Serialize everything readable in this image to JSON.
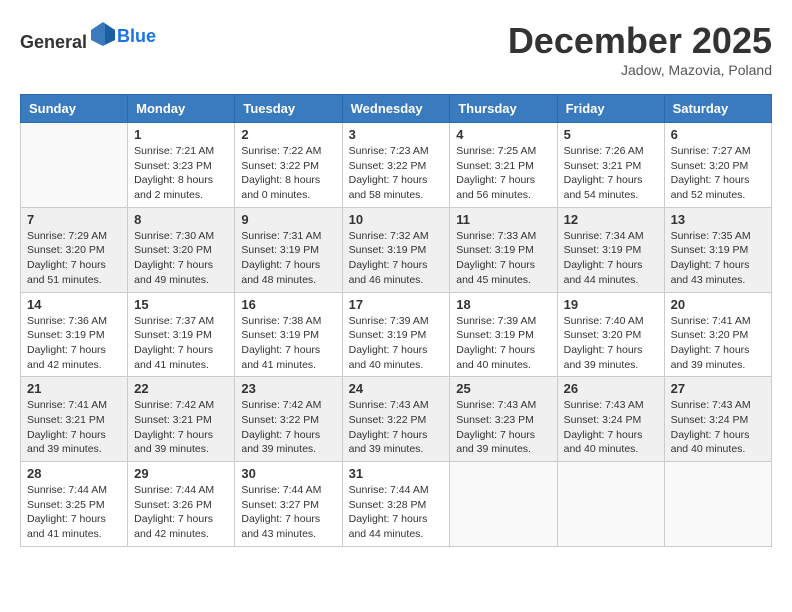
{
  "header": {
    "logo_general": "General",
    "logo_blue": "Blue",
    "month": "December 2025",
    "location": "Jadow, Mazovia, Poland"
  },
  "days_of_week": [
    "Sunday",
    "Monday",
    "Tuesday",
    "Wednesday",
    "Thursday",
    "Friday",
    "Saturday"
  ],
  "weeks": [
    [
      {
        "day": "",
        "info": ""
      },
      {
        "day": "1",
        "info": "Sunrise: 7:21 AM\nSunset: 3:23 PM\nDaylight: 8 hours\nand 2 minutes."
      },
      {
        "day": "2",
        "info": "Sunrise: 7:22 AM\nSunset: 3:22 PM\nDaylight: 8 hours\nand 0 minutes."
      },
      {
        "day": "3",
        "info": "Sunrise: 7:23 AM\nSunset: 3:22 PM\nDaylight: 7 hours\nand 58 minutes."
      },
      {
        "day": "4",
        "info": "Sunrise: 7:25 AM\nSunset: 3:21 PM\nDaylight: 7 hours\nand 56 minutes."
      },
      {
        "day": "5",
        "info": "Sunrise: 7:26 AM\nSunset: 3:21 PM\nDaylight: 7 hours\nand 54 minutes."
      },
      {
        "day": "6",
        "info": "Sunrise: 7:27 AM\nSunset: 3:20 PM\nDaylight: 7 hours\nand 52 minutes."
      }
    ],
    [
      {
        "day": "7",
        "info": "Sunrise: 7:29 AM\nSunset: 3:20 PM\nDaylight: 7 hours\nand 51 minutes."
      },
      {
        "day": "8",
        "info": "Sunrise: 7:30 AM\nSunset: 3:20 PM\nDaylight: 7 hours\nand 49 minutes."
      },
      {
        "day": "9",
        "info": "Sunrise: 7:31 AM\nSunset: 3:19 PM\nDaylight: 7 hours\nand 48 minutes."
      },
      {
        "day": "10",
        "info": "Sunrise: 7:32 AM\nSunset: 3:19 PM\nDaylight: 7 hours\nand 46 minutes."
      },
      {
        "day": "11",
        "info": "Sunrise: 7:33 AM\nSunset: 3:19 PM\nDaylight: 7 hours\nand 45 minutes."
      },
      {
        "day": "12",
        "info": "Sunrise: 7:34 AM\nSunset: 3:19 PM\nDaylight: 7 hours\nand 44 minutes."
      },
      {
        "day": "13",
        "info": "Sunrise: 7:35 AM\nSunset: 3:19 PM\nDaylight: 7 hours\nand 43 minutes."
      }
    ],
    [
      {
        "day": "14",
        "info": "Sunrise: 7:36 AM\nSunset: 3:19 PM\nDaylight: 7 hours\nand 42 minutes."
      },
      {
        "day": "15",
        "info": "Sunrise: 7:37 AM\nSunset: 3:19 PM\nDaylight: 7 hours\nand 41 minutes."
      },
      {
        "day": "16",
        "info": "Sunrise: 7:38 AM\nSunset: 3:19 PM\nDaylight: 7 hours\nand 41 minutes."
      },
      {
        "day": "17",
        "info": "Sunrise: 7:39 AM\nSunset: 3:19 PM\nDaylight: 7 hours\nand 40 minutes."
      },
      {
        "day": "18",
        "info": "Sunrise: 7:39 AM\nSunset: 3:19 PM\nDaylight: 7 hours\nand 40 minutes."
      },
      {
        "day": "19",
        "info": "Sunrise: 7:40 AM\nSunset: 3:20 PM\nDaylight: 7 hours\nand 39 minutes."
      },
      {
        "day": "20",
        "info": "Sunrise: 7:41 AM\nSunset: 3:20 PM\nDaylight: 7 hours\nand 39 minutes."
      }
    ],
    [
      {
        "day": "21",
        "info": "Sunrise: 7:41 AM\nSunset: 3:21 PM\nDaylight: 7 hours\nand 39 minutes."
      },
      {
        "day": "22",
        "info": "Sunrise: 7:42 AM\nSunset: 3:21 PM\nDaylight: 7 hours\nand 39 minutes."
      },
      {
        "day": "23",
        "info": "Sunrise: 7:42 AM\nSunset: 3:22 PM\nDaylight: 7 hours\nand 39 minutes."
      },
      {
        "day": "24",
        "info": "Sunrise: 7:43 AM\nSunset: 3:22 PM\nDaylight: 7 hours\nand 39 minutes."
      },
      {
        "day": "25",
        "info": "Sunrise: 7:43 AM\nSunset: 3:23 PM\nDaylight: 7 hours\nand 39 minutes."
      },
      {
        "day": "26",
        "info": "Sunrise: 7:43 AM\nSunset: 3:24 PM\nDaylight: 7 hours\nand 40 minutes."
      },
      {
        "day": "27",
        "info": "Sunrise: 7:43 AM\nSunset: 3:24 PM\nDaylight: 7 hours\nand 40 minutes."
      }
    ],
    [
      {
        "day": "28",
        "info": "Sunrise: 7:44 AM\nSunset: 3:25 PM\nDaylight: 7 hours\nand 41 minutes."
      },
      {
        "day": "29",
        "info": "Sunrise: 7:44 AM\nSunset: 3:26 PM\nDaylight: 7 hours\nand 42 minutes."
      },
      {
        "day": "30",
        "info": "Sunrise: 7:44 AM\nSunset: 3:27 PM\nDaylight: 7 hours\nand 43 minutes."
      },
      {
        "day": "31",
        "info": "Sunrise: 7:44 AM\nSunset: 3:28 PM\nDaylight: 7 hours\nand 44 minutes."
      },
      {
        "day": "",
        "info": ""
      },
      {
        "day": "",
        "info": ""
      },
      {
        "day": "",
        "info": ""
      }
    ]
  ]
}
